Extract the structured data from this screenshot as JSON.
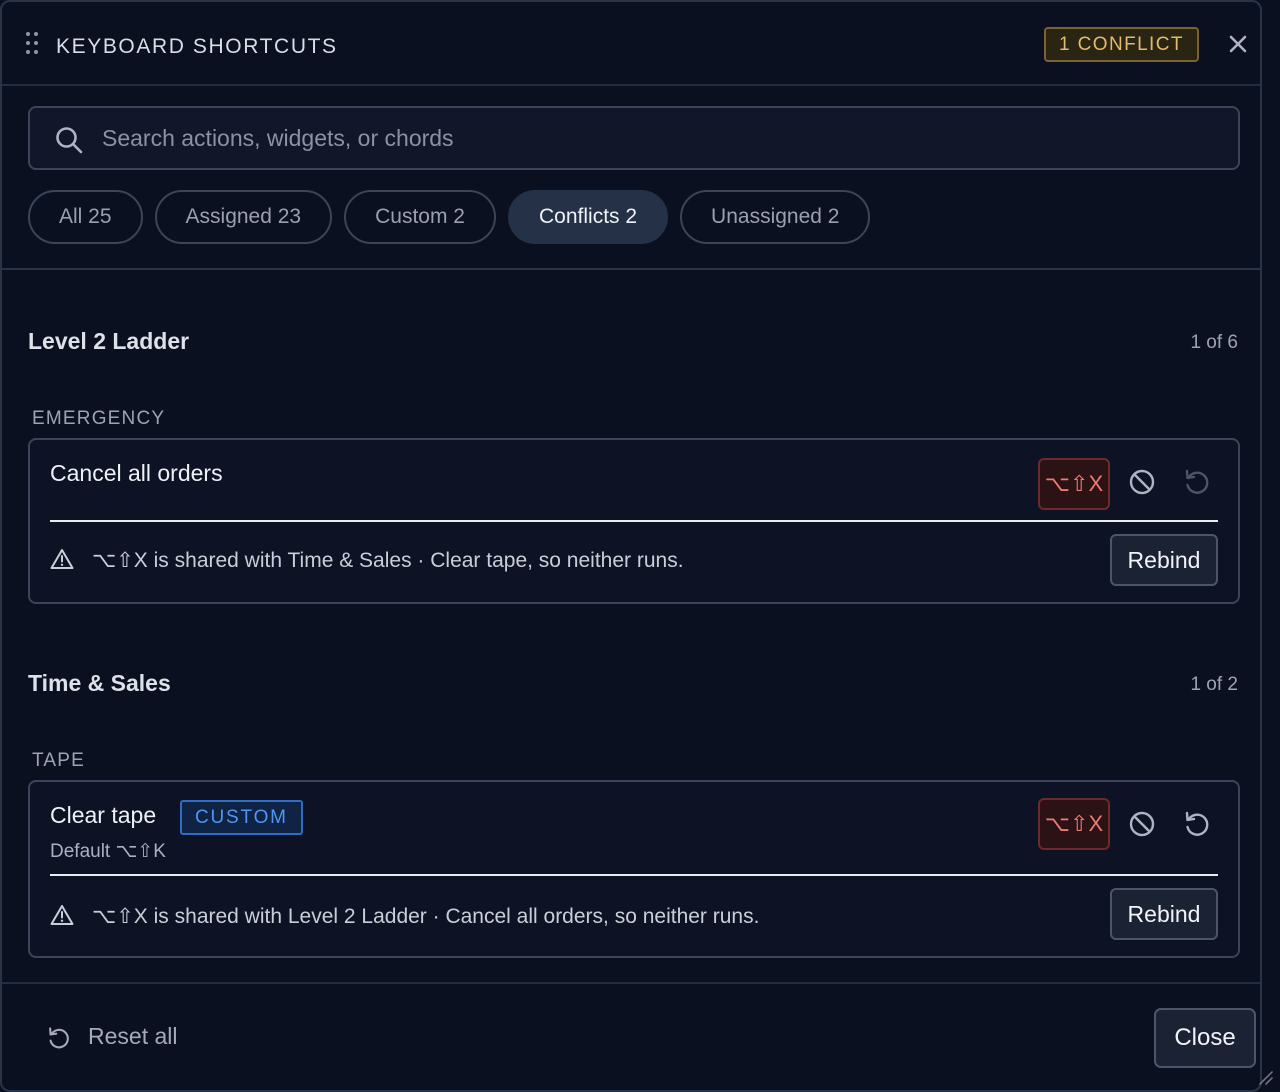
{
  "header": {
    "title": "KEYBOARD SHORTCUTS",
    "conflict_badge": "1 CONFLICT",
    "close_icon": "close-icon",
    "grip_icon": "drag-handle-icon"
  },
  "search": {
    "placeholder": "Search actions, widgets, or chords",
    "value": ""
  },
  "filters": [
    {
      "label": "All 25",
      "active": false
    },
    {
      "label": "Assigned 23",
      "active": false
    },
    {
      "label": "Custom 2",
      "active": false
    },
    {
      "label": "Conflicts 2",
      "active": true
    },
    {
      "label": "Unassigned 2",
      "active": false
    }
  ],
  "sections": [
    {
      "title": "Level 2 Ladder",
      "count": "1 of 6",
      "group": "EMERGENCY",
      "action": {
        "name": "Cancel all orders",
        "chord": "⌥⇧X",
        "warning": "⌥⇧X is shared with Time & Sales · Clear tape, so neither runs.",
        "rebind_label": "Rebind"
      }
    },
    {
      "title": "Time & Sales",
      "count": "1 of 2",
      "group": "TAPE",
      "action": {
        "name": "Clear tape",
        "tag": "CUSTOM",
        "default": "Default ⌥⇧K",
        "chord": "⌥⇧X",
        "warning": "⌥⇧X is shared with Level 2 Ladder · Cancel all orders, so neither runs.",
        "rebind_label": "Rebind"
      }
    }
  ],
  "footer": {
    "reset_all": "Reset all",
    "close": "Close"
  },
  "colors": {
    "background": "#0b1020",
    "conflict": "#ef7a72",
    "warning_badge": "#e4bb6d",
    "custom_tag": "#4f95f5"
  }
}
